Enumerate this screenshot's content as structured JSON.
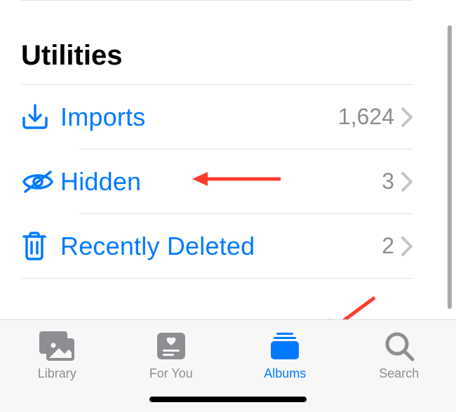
{
  "section": {
    "title": "Utilities"
  },
  "rows": {
    "imports": {
      "label": "Imports",
      "count": "1,624"
    },
    "hidden": {
      "label": "Hidden",
      "count": "3"
    },
    "recentlyDeleted": {
      "label": "Recently Deleted",
      "count": "2"
    }
  },
  "tabs": {
    "library": {
      "label": "Library"
    },
    "forYou": {
      "label": "For You"
    },
    "albums": {
      "label": "Albums"
    },
    "search": {
      "label": "Search"
    }
  },
  "colors": {
    "accent": "#007aff",
    "inactive": "#8e8e93",
    "chevron": "#c5c5c8",
    "annotation": "#ff3b30"
  }
}
